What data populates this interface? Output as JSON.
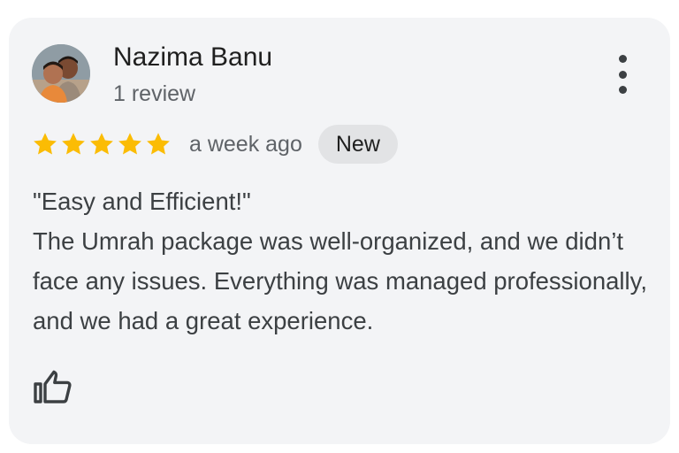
{
  "review": {
    "author_name": "Nazima Banu",
    "review_count": "1 review",
    "rating": 5,
    "rating_max": 5,
    "time_ago": "a week ago",
    "badge": "New",
    "title": "\"Easy and Efficient!\"",
    "body": "The Umrah package was well-organized, and we didn’t face any issues. Everything was managed professionally, and we had a great experience."
  },
  "icons": {
    "more": "more-vert-icon",
    "star": "star-icon",
    "like": "thumbs-up-icon"
  },
  "colors": {
    "card_background": "#f3f4f6",
    "star": "#fbbc04",
    "badge_background": "#e2e3e5",
    "primary_text": "#1f1f1f",
    "secondary_text": "#5f6368"
  }
}
